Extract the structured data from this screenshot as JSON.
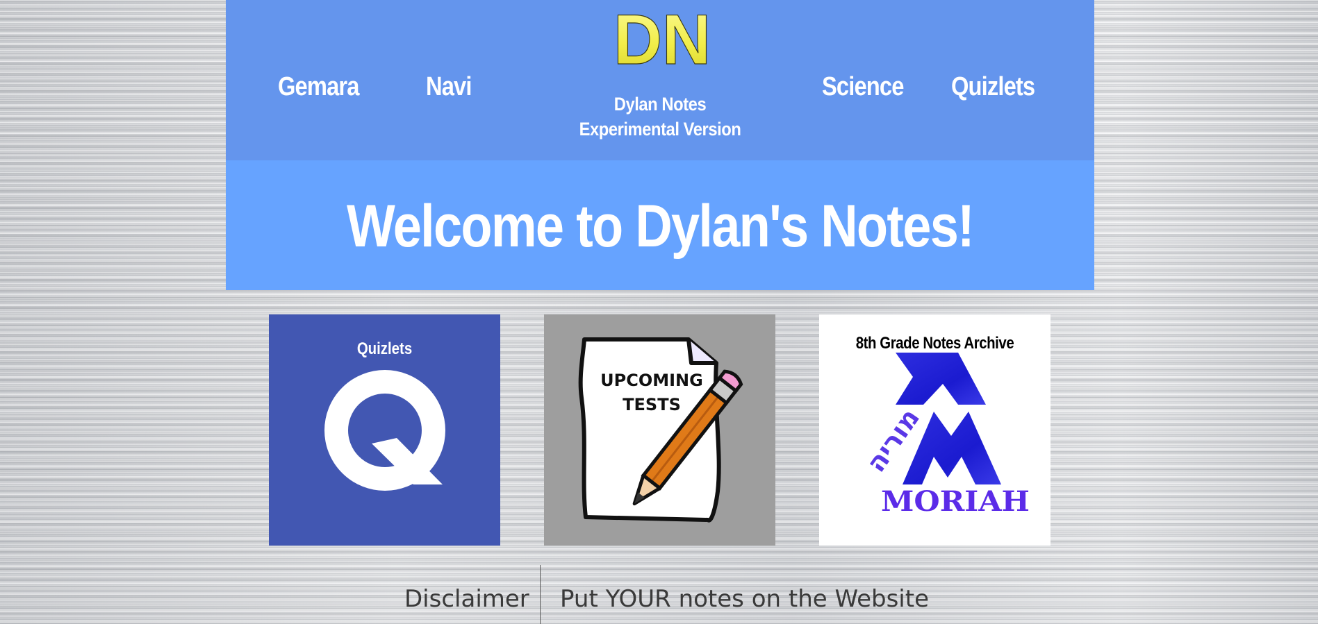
{
  "header": {
    "logo_text": "DN",
    "nav_left": [
      "Gemara",
      "Navi"
    ],
    "nav_right": [
      "Science",
      "Quizlets"
    ],
    "brand_line1": "Dylan Notes",
    "brand_line2": "Experimental Version"
  },
  "welcome": {
    "title": "Welcome to Dylan's Notes!"
  },
  "tiles": {
    "quizlets": {
      "label": "Quizlets",
      "icon": "quizlet-q-icon",
      "icon_letter": "Q"
    },
    "upcoming_tests": {
      "image_text_line1": "UPCOMING",
      "image_text_line2": "TESTS",
      "icon": "paper-pencil-icon"
    },
    "archive": {
      "label": "8th Grade Notes Archive",
      "logo_word": "MORIAH",
      "logo_hebrew": "מוריה",
      "icon": "moriah-logo"
    }
  },
  "footer": {
    "disclaimer": "Disclaimer",
    "put_notes": "Put YOUR notes on the Website"
  },
  "colors": {
    "header_bg": "#6495ed",
    "welcome_bg": "#66a3ff",
    "quizlet_bg": "#4257b2",
    "logo_yellow": "#f2ee4a"
  }
}
